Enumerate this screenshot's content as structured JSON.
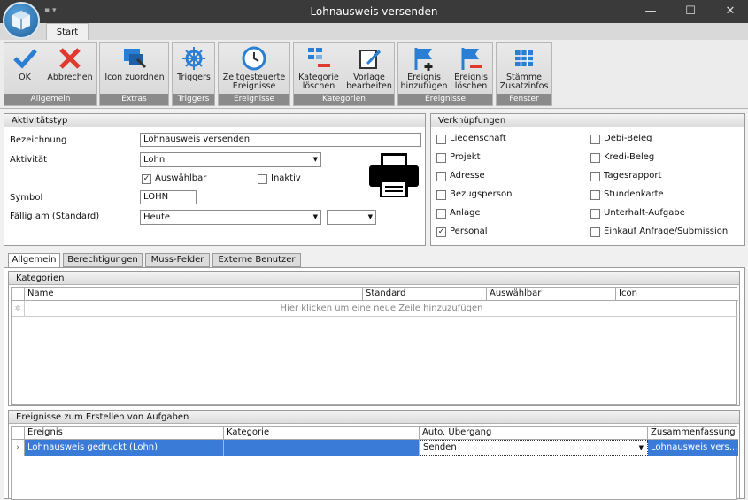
{
  "window": {
    "title": "Lohnausweis versenden"
  },
  "tabs": {
    "start": "Start"
  },
  "ribbon": {
    "groups": {
      "allgemein": "Allgemein",
      "extras": "Extras",
      "triggers": "Triggers",
      "ereignisse": "Ereignisse",
      "kategorien": "Kategorien",
      "ereignisse2": "Ereignisse",
      "fenster": "Fenster"
    },
    "buttons": {
      "ok": "OK",
      "abbrechen": "Abbrechen",
      "icon_zuordnen": "Icon zuordnen",
      "triggers": "Triggers",
      "zeitgesteuerte_1": "Zeitgesteuerte",
      "zeitgesteuerte_2": "Ereignisse",
      "kategorie_loeschen_1": "Kategorie",
      "kategorie_loeschen_2": "löschen",
      "vorlage_1": "Vorlage",
      "vorlage_2": "bearbeiten",
      "ereignis_hinzu_1": "Ereignis",
      "ereignis_hinzu_2": "hinzufügen",
      "ereignis_loeschen_1": "Ereignis",
      "ereignis_loeschen_2": "löschen",
      "staemme_1": "Stämme",
      "staemme_2": "Zusatzinfos"
    }
  },
  "aktivitaetstyp": {
    "header": "Aktivitätstyp",
    "bezeichnung_label": "Bezeichnung",
    "bezeichnung_value": "Lohnausweis versenden",
    "aktivitaet_label": "Aktivität",
    "aktivitaet_value": "Lohn",
    "auswaehlbar_label": "Auswählbar",
    "inaktiv_label": "Inaktiv",
    "symbol_label": "Symbol",
    "symbol_value": "LOHN",
    "faellig_label": "Fällig am (Standard)",
    "faellig_value": "Heute",
    "faellig_value2": ""
  },
  "verknuepfungen": {
    "header": "Verknüpfungen",
    "left": [
      {
        "label": "Liegenschaft",
        "checked": false
      },
      {
        "label": "Projekt",
        "checked": false
      },
      {
        "label": "Adresse",
        "checked": false
      },
      {
        "label": "Bezugsperson",
        "checked": false
      },
      {
        "label": "Anlage",
        "checked": false
      },
      {
        "label": "Personal",
        "checked": true
      }
    ],
    "right": [
      {
        "label": "Debi-Beleg",
        "checked": false
      },
      {
        "label": "Kredi-Beleg",
        "checked": false
      },
      {
        "label": "Tagesrapport",
        "checked": false
      },
      {
        "label": "Stundenkarte",
        "checked": false
      },
      {
        "label": "Unterhalt-Aufgabe",
        "checked": false
      },
      {
        "label": "Einkauf Anfrage/Submission",
        "checked": false
      }
    ]
  },
  "detail_tabs": [
    "Allgemein",
    "Berechtigungen",
    "Muss-Felder",
    "Externe Benutzer"
  ],
  "kategorien": {
    "header": "Kategorien",
    "columns": [
      "Name",
      "Standard",
      "Auswählbar",
      "Icon"
    ],
    "new_row_hint": "Hier klicken um eine neue Zeile hinzuzufügen"
  },
  "ereignisse": {
    "header": "Ereignisse zum Erstellen von Aufgaben",
    "columns": [
      "Ereignis",
      "Kategorie",
      "Auto. Übergang",
      "Zusammenfassung"
    ],
    "rows": [
      {
        "ereignis": "Lohnausweis gedruckt (Lohn)",
        "kategorie": "",
        "uebergang": "Senden",
        "zusammenfassung": "Lohnausweis vers..."
      }
    ]
  },
  "colors": {
    "accent": "#3b7bd8",
    "ribbon_group_label": "#8a8a8a",
    "titlebar": "#3a3a3a"
  }
}
